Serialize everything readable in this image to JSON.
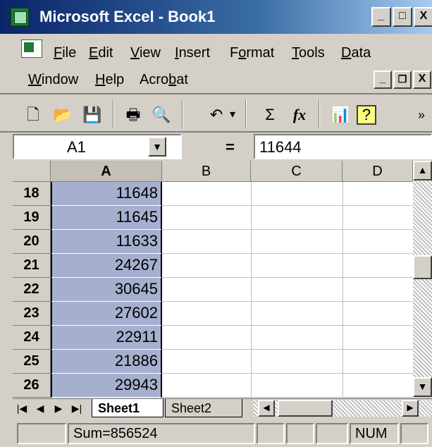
{
  "window": {
    "title": "Microsoft Excel - Book1",
    "minimize": "_",
    "maximize": "□",
    "close": "X"
  },
  "menu": {
    "row1": [
      {
        "pre": "",
        "u": "F",
        "post": "ile"
      },
      {
        "pre": "",
        "u": "E",
        "post": "dit"
      },
      {
        "pre": "",
        "u": "V",
        "post": "iew"
      },
      {
        "pre": "",
        "u": "I",
        "post": "nsert"
      },
      {
        "pre": "F",
        "u": "o",
        "post": "rmat"
      },
      {
        "pre": "",
        "u": "T",
        "post": "ools"
      },
      {
        "pre": "",
        "u": "D",
        "post": "ata"
      }
    ],
    "row2": [
      {
        "pre": "",
        "u": "W",
        "post": "indow"
      },
      {
        "pre": "",
        "u": "H",
        "post": "elp"
      },
      {
        "pre": "Acro",
        "u": "b",
        "post": "at"
      }
    ],
    "doc_min": "_",
    "doc_restore": "❐",
    "doc_close": "X"
  },
  "toolbar": {
    "new": "🗋",
    "open": "📂",
    "save": "💾",
    "print": "🖶",
    "preview": "🔍",
    "undo": "↶",
    "undo_drop": "▾",
    "autosum": "Σ",
    "function": "fx",
    "chart": "📊",
    "help": "?",
    "more": "»"
  },
  "formula_bar": {
    "name_box": "A1",
    "equals": "=",
    "value": "11644"
  },
  "columns": [
    "A",
    "B",
    "C",
    "D"
  ],
  "rows": [
    {
      "num": "18",
      "a": "11648"
    },
    {
      "num": "19",
      "a": "11645"
    },
    {
      "num": "20",
      "a": "11633"
    },
    {
      "num": "21",
      "a": "24267"
    },
    {
      "num": "22",
      "a": "30645"
    },
    {
      "num": "23",
      "a": "27602"
    },
    {
      "num": "24",
      "a": "22911"
    },
    {
      "num": "25",
      "a": "21886"
    },
    {
      "num": "26",
      "a": "29943"
    }
  ],
  "sheets": {
    "active": "Sheet1",
    "other": "Sheet2"
  },
  "status": {
    "sum": "Sum=856524",
    "num": "NUM"
  }
}
